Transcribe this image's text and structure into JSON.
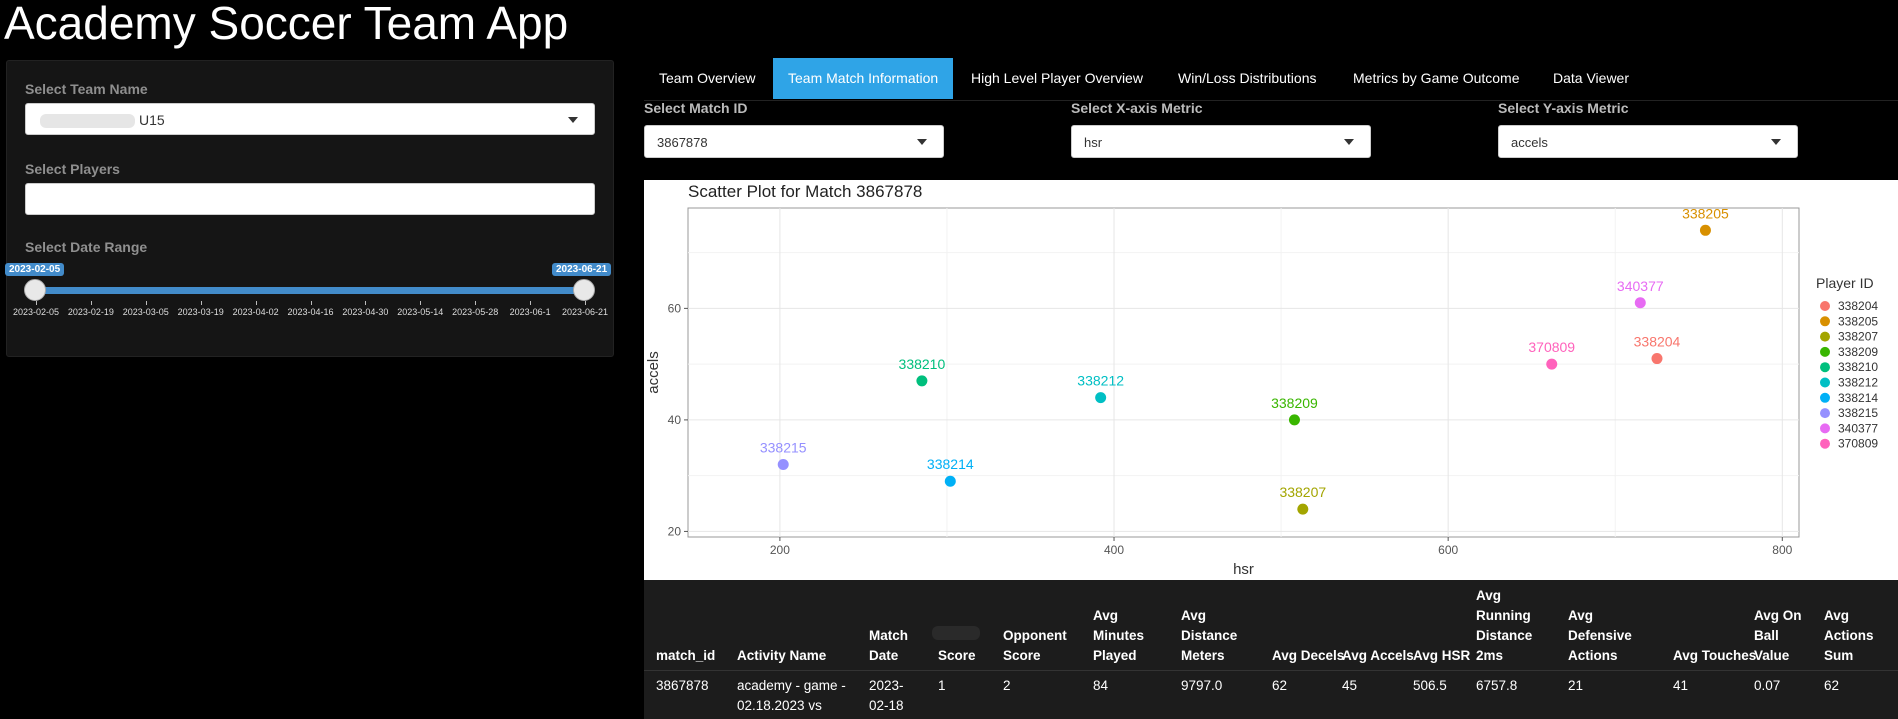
{
  "app": {
    "title": "Academy Soccer Team App"
  },
  "sidebar": {
    "team_label": "Select Team Name",
    "team_value": "U15",
    "players_label": "Select Players",
    "players_value": "",
    "date_label": "Select Date Range",
    "date_from": "2023-02-05",
    "date_to": "2023-06-21",
    "ticks": [
      "2023-02-05",
      "2023-02-19",
      "2023-03-05",
      "2023-03-19",
      "2023-04-02",
      "2023-04-16",
      "2023-04-30",
      "2023-05-14",
      "2023-05-28",
      "2023-06-1",
      "2023-06-21"
    ],
    "slider_color": "#428bca"
  },
  "tabs": [
    {
      "label": "Team Overview",
      "active": false
    },
    {
      "label": "Team Match Information",
      "active": true
    },
    {
      "label": "High Level Player Overview",
      "active": false
    },
    {
      "label": "Win/Loss Distributions",
      "active": false
    },
    {
      "label": "Metrics by Game Outcome",
      "active": false
    },
    {
      "label": "Data Viewer",
      "active": false
    }
  ],
  "filters": {
    "match_label": "Select Match ID",
    "match_value": "3867878",
    "x_label": "Select X-axis Metric",
    "x_value": "hsr",
    "y_label": "Select Y-axis Metric",
    "y_value": "accels"
  },
  "chart_data": {
    "type": "scatter",
    "title": "Scatter Plot for Match 3867878",
    "xlabel": "hsr",
    "ylabel": "accels",
    "xlim": [
      145,
      810
    ],
    "ylim": [
      19,
      78
    ],
    "xticks": [
      200,
      400,
      600,
      800
    ],
    "yticks": [
      20,
      40,
      60
    ],
    "grid": true,
    "legend_title": "Player ID",
    "legend_position": "right",
    "points": [
      {
        "label": "338204",
        "x": 725,
        "y": 51,
        "color": "#F8766D"
      },
      {
        "label": "338205",
        "x": 754,
        "y": 74,
        "color": "#D89000"
      },
      {
        "label": "338207",
        "x": 513,
        "y": 24,
        "color": "#A3A500"
      },
      {
        "label": "338209",
        "x": 508,
        "y": 40,
        "color": "#39B600"
      },
      {
        "label": "338210",
        "x": 285,
        "y": 47,
        "color": "#00BF7D"
      },
      {
        "label": "338212",
        "x": 392,
        "y": 44,
        "color": "#00BFC4"
      },
      {
        "label": "338214",
        "x": 302,
        "y": 29,
        "color": "#00B0F6"
      },
      {
        "label": "338215",
        "x": 202,
        "y": 32,
        "color": "#9590FF"
      },
      {
        "label": "340377",
        "x": 715,
        "y": 61,
        "color": "#E76BF3"
      },
      {
        "label": "370809",
        "x": 662,
        "y": 50,
        "color": "#FF62BC"
      }
    ]
  },
  "table": {
    "headers": [
      "match_id",
      "Activity Name",
      "Match Date",
      "Score",
      "Opponent Score",
      "Avg Minutes Played",
      "Avg Distance Meters",
      "Avg Decels",
      "Avg Accels",
      "Avg HSR",
      "Avg Running Distance 2ms",
      "Avg Defensive Actions",
      "Avg Touches",
      "Avg On Ball Value",
      "Avg Actions Sum"
    ],
    "rows": [
      [
        "3867878",
        "academy - game - 02.18.2023 vs",
        "2023-02-18",
        "1",
        "2",
        "84",
        "9797.0",
        "62",
        "45",
        "506.5",
        "6757.8",
        "21",
        "41",
        "0.07",
        "62"
      ]
    ]
  }
}
